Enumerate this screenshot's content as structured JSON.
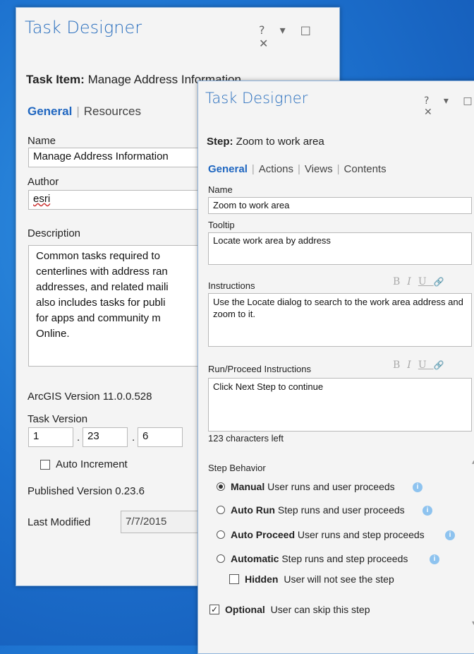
{
  "panel_a": {
    "title": "Task Designer",
    "help": "?",
    "menu": "▾",
    "maximize": "□",
    "close": "✕",
    "header_key": "Task Item:",
    "header_value": "Manage Address Information",
    "tabs": {
      "general": "General",
      "resources": "Resources"
    },
    "name_label": "Name",
    "name_value": "Manage Address Information",
    "author_label": "Author",
    "author_value": "esri",
    "description_label": "Description",
    "description_lines": [
      "Common tasks required to",
      "centerlines with address ran",
      "addresses, and related maili",
      "also includes tasks for publi",
      "for apps and community m",
      "Online."
    ],
    "arcgis_version": "ArcGIS Version 11.0.0.528",
    "task_version_label": "Task Version",
    "version_parts": [
      "1",
      "23",
      "6"
    ],
    "version_dot": ".",
    "auto_increment": "Auto Increment",
    "published_version": "Published Version 0.23.6",
    "last_modified_label": "Last Modified",
    "last_modified_value": "7/7/2015"
  },
  "panel_b": {
    "title": "Task Designer",
    "help": "?",
    "menu": "▾",
    "maximize": "□",
    "close": "✕",
    "header_key": "Step:",
    "header_value": "Zoom to work area",
    "tabs": {
      "general": "General",
      "actions": "Actions",
      "views": "Views",
      "contents": "Contents"
    },
    "name_label": "Name",
    "name_value": "Zoom to work area",
    "tooltip_label": "Tooltip",
    "tooltip_value": "Locate work area by address",
    "instructions_label": "Instructions",
    "instructions_value": "Use the Locate dialog to search to the work area address and zoom to it.",
    "run_label": "Run/Proceed Instructions",
    "run_value": "Click Next Step to continue",
    "chars_left": "123 characters left",
    "format": {
      "bold": "B",
      "italic": "I",
      "underline": "U",
      "link": "🔗"
    },
    "step_behavior_label": "Step Behavior",
    "behaviors": [
      {
        "name": "Manual",
        "desc": "User runs and user proceeds",
        "selected": true
      },
      {
        "name": "Auto Run",
        "desc": "Step runs and user proceeds",
        "selected": false
      },
      {
        "name": "Auto Proceed",
        "desc": "User runs and step proceeds",
        "selected": false
      },
      {
        "name": "Automatic",
        "desc": "Step runs and step proceeds",
        "selected": false
      }
    ],
    "hidden": {
      "name": "Hidden",
      "desc": "User will not see the step",
      "checked": false
    },
    "optional": {
      "name": "Optional",
      "desc": "User can skip this step",
      "checked": true
    },
    "info_glyph": "i",
    "check_glyph": "✓"
  },
  "colors": {
    "desktop": "#1d72cf",
    "title_blue": "#2a6fbe",
    "tab_active": "#1f66c0",
    "info": "#8ec3ef"
  }
}
